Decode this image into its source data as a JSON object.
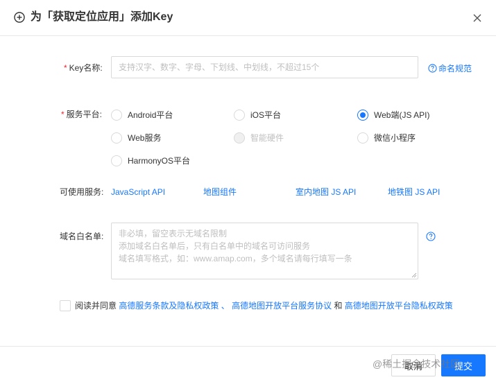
{
  "dialog": {
    "title": "为「获取定位应用」添加Key",
    "accent_color": "#1677ff"
  },
  "key_name": {
    "required_mark": "*",
    "label": "Key名称:",
    "placeholder": "支持汉字、数字、字母、下划线、中划线，不超过15个",
    "value": "",
    "help_link": "命名规范"
  },
  "platform": {
    "required_mark": "*",
    "label": "服务平台:",
    "options": [
      {
        "label": "Android平台",
        "checked": false,
        "disabled": false
      },
      {
        "label": "iOS平台",
        "checked": false,
        "disabled": false
      },
      {
        "label": "Web端(JS API)",
        "checked": true,
        "disabled": false
      },
      {
        "label": "Web服务",
        "checked": false,
        "disabled": false
      },
      {
        "label": "智能硬件",
        "checked": false,
        "disabled": true
      },
      {
        "label": "微信小程序",
        "checked": false,
        "disabled": false
      },
      {
        "label": "HarmonyOS平台",
        "checked": false,
        "disabled": false
      }
    ]
  },
  "services": {
    "label": "可使用服务:",
    "links": [
      "JavaScript API",
      "地图组件",
      "室内地图 JS API",
      "地铁图 JS API"
    ]
  },
  "domain_whitelist": {
    "label": "域名白名单:",
    "placeholder_lines": [
      "非必填，留空表示无域名限制",
      "添加域名白名单后，只有白名单中的域名可访问服务",
      "域名填写格式，如：www.amap.com，多个域名请每行填写一条"
    ]
  },
  "agreement": {
    "prefix": "阅读并同意",
    "link1": "高德服务条款及隐私权政策",
    "sep1": "、",
    "link2": "高德地图开放平台服务协议",
    "sep2": "和",
    "link3": "高德地图开放平台隐私权政策"
  },
  "footer": {
    "cancel_label": "取消",
    "confirm_label": "提交",
    "watermark": "@稀土掘金技术社区"
  }
}
